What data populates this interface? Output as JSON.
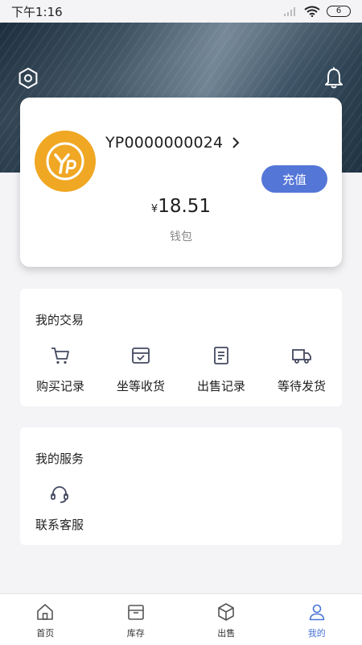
{
  "status_bar": {
    "time": "下午1:16",
    "battery": "6"
  },
  "header": {
    "settings_icon": "settings-hexagon-icon",
    "bell_icon": "bell-icon"
  },
  "wallet": {
    "account_id": "YP0000000024",
    "recharge_label": "充值",
    "currency_symbol": "¥",
    "amount": "18.51",
    "label": "钱包",
    "avatar_icon": "yp-logo",
    "avatar_color": "#f0a723",
    "accent": "#5476d7"
  },
  "trade": {
    "title": "我的交易",
    "items": [
      {
        "label": "购买记录",
        "icon": "cart-icon"
      },
      {
        "label": "坐等收货",
        "icon": "inbox-check-icon"
      },
      {
        "label": "出售记录",
        "icon": "document-icon"
      },
      {
        "label": "等待发货",
        "icon": "truck-icon"
      }
    ]
  },
  "service": {
    "title": "我的服务",
    "items": [
      {
        "label": "联系客服",
        "icon": "headset-icon"
      }
    ]
  },
  "tabs": [
    {
      "label": "首页",
      "icon": "home-icon"
    },
    {
      "label": "库存",
      "icon": "inventory-box-icon"
    },
    {
      "label": "出售",
      "icon": "package-icon"
    },
    {
      "label": "我的",
      "icon": "user-icon",
      "active": true
    }
  ],
  "colors": {
    "active_tab": "#4a72d8",
    "icon_stroke": "#444a60"
  }
}
